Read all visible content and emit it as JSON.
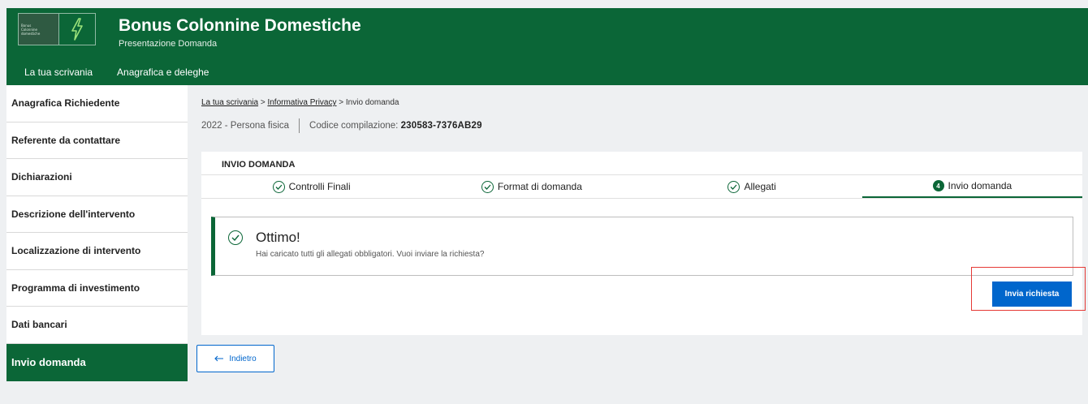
{
  "header": {
    "logo_text": "Bonus\nColonnine\ndomestiche",
    "title": "Bonus Colonnine Domestiche",
    "subtitle": "Presentazione Domanda",
    "nav": [
      "La tua scrivania",
      "Anagrafica e deleghe"
    ]
  },
  "sidebar": {
    "items": [
      "Anagrafica Richiedente",
      "Referente da contattare",
      "Dichiarazioni",
      "Descrizione dell'intervento",
      "Localizzazione di intervento",
      "Programma di investimento",
      "Dati bancari",
      "Invio domanda"
    ],
    "active": "Invio domanda"
  },
  "breadcrumb": {
    "items": [
      "La tua scrivania",
      "Informativa Privacy",
      "Invio domanda"
    ],
    "separator": ">"
  },
  "meta": {
    "year_type": "2022 - Persona fisica",
    "code_label": "Codice compilazione:",
    "code_value": "230583-7376AB29"
  },
  "card": {
    "title": "INVIO DOMANDA",
    "steps": [
      {
        "label": "Controlli Finali",
        "status": "done"
      },
      {
        "label": "Format di domanda",
        "status": "done"
      },
      {
        "label": "Allegati",
        "status": "done"
      },
      {
        "label": "Invio domanda",
        "status": "current",
        "number": "4"
      }
    ],
    "alert": {
      "title": "Ottimo!",
      "text": "Hai caricato tutti gli allegati obbligatori. Vuoi inviare la richiesta?"
    },
    "send_button": "Invia richiesta"
  },
  "back_button": "Indietro",
  "colors": {
    "brand_green": "#0b6637",
    "primary_blue": "#0066cc",
    "highlight_red": "#e53935"
  }
}
